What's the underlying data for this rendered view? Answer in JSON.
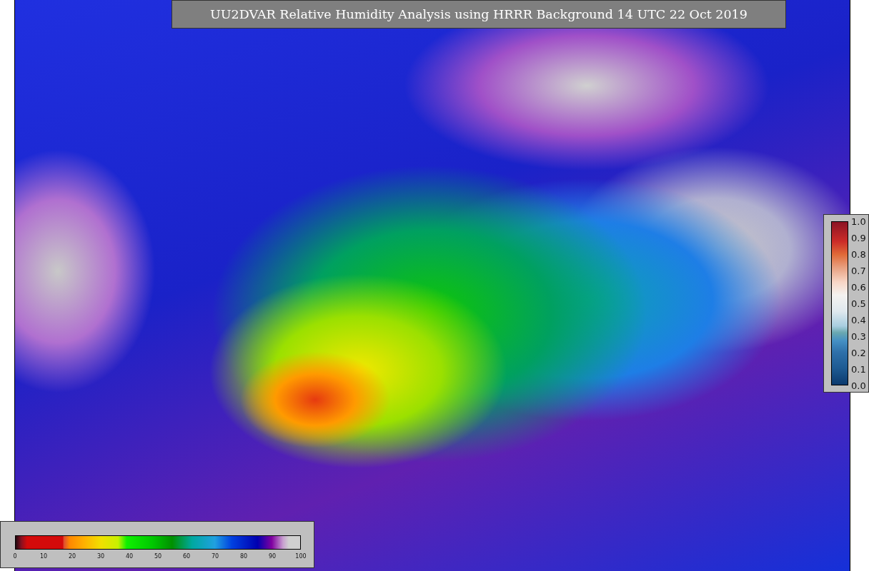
{
  "title": "UU2DVAR Relative Humidity Analysis using HRRR Background 14 UTC 22 Oct 2019",
  "humidity_colorbar": {
    "ticks": [
      "0",
      "10",
      "20",
      "30",
      "40",
      "50",
      "60",
      "70",
      "80",
      "90",
      "100"
    ]
  },
  "difference_colorbar": {
    "ticks": [
      "1.0",
      "0.9",
      "0.8",
      "0.7",
      "0.6",
      "0.5",
      "0.4",
      "0.3",
      "0.2",
      "0.1",
      "0.0"
    ]
  }
}
